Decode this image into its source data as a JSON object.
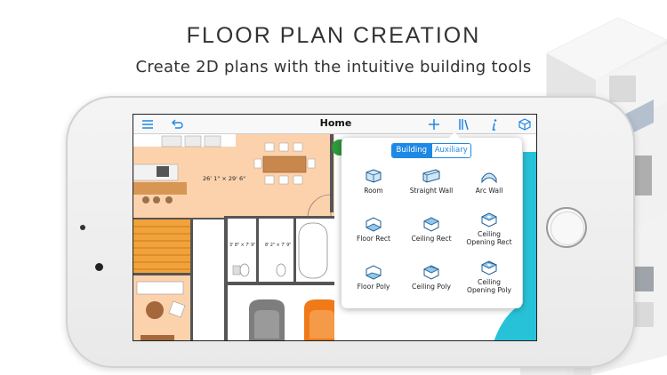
{
  "headline": "FLOOR PLAN CREATION",
  "subheadline": "Create 2D plans with the intuitive building tools",
  "app": {
    "title": "Home",
    "toolbar": {
      "menu_icon": "hamburger-menu-icon",
      "undo_icon": "undo-arrow-icon",
      "add_icon": "plus-icon",
      "library_icon": "books-library-icon",
      "info_icon": "info-icon",
      "view3d_icon": "3d-box-icon"
    },
    "accent_color": "#1e88e5",
    "popover": {
      "tabs": [
        {
          "label": "Building",
          "selected": true
        },
        {
          "label": "Auxiliary",
          "selected": false
        }
      ],
      "tools": [
        {
          "label": "Room",
          "icon": "room-icon"
        },
        {
          "label": "Straight Wall",
          "icon": "straight-wall-icon"
        },
        {
          "label": "Arc Wall",
          "icon": "arc-wall-icon"
        },
        {
          "label": "Floor Rect",
          "icon": "floor-rect-icon"
        },
        {
          "label": "Ceiling Rect",
          "icon": "ceiling-rect-icon"
        },
        {
          "label": "Ceiling Opening Rect",
          "label_lines": [
            "Ceiling",
            "Opening Rect"
          ],
          "icon": "ceiling-opening-rect-icon"
        },
        {
          "label": "Floor Poly",
          "icon": "floor-poly-icon"
        },
        {
          "label": "Ceiling Poly",
          "icon": "ceiling-poly-icon"
        },
        {
          "label": "Ceiling Opening Poly",
          "label_lines": [
            "Ceiling",
            "Opening Poly"
          ],
          "icon": "ceiling-opening-poly-icon"
        }
      ]
    },
    "plan": {
      "room_dimension": "26' 1\" × 29' 6\"",
      "bath1_dimension": "3' 8\" × 7' 9\"",
      "bath2_dimension": "8' 2\" × 7' 9\""
    }
  }
}
